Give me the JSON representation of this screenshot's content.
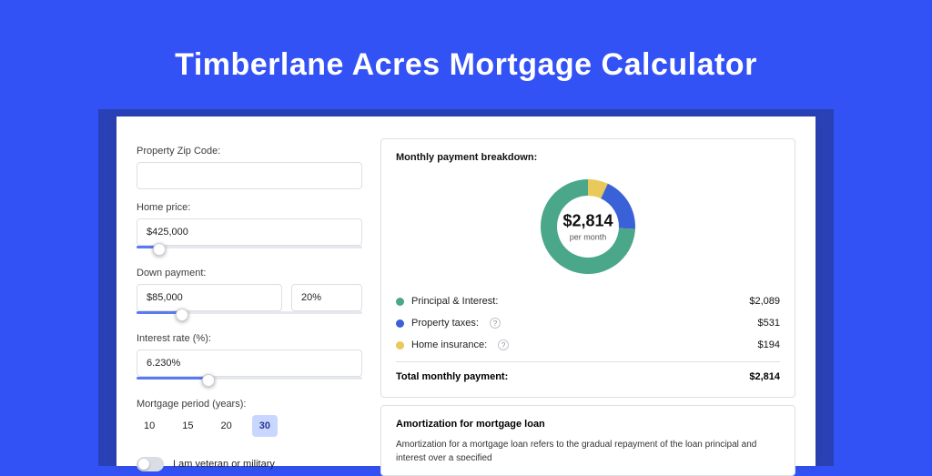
{
  "title": "Timberlane Acres Mortgage Calculator",
  "left": {
    "zip_label": "Property Zip Code:",
    "zip_value": "",
    "home_label": "Home price:",
    "home_value": "$425,000",
    "home_slider_pct": 10,
    "down_label": "Down payment:",
    "down_value": "$85,000",
    "down_pct_value": "20%",
    "down_slider_pct": 20,
    "rate_label": "Interest rate (%):",
    "rate_value": "6.230%",
    "rate_slider_pct": 32,
    "period_label": "Mortgage period (years):",
    "periods": [
      "10",
      "15",
      "20",
      "30"
    ],
    "period_active_index": 3,
    "vet_label": "I am veteran or military",
    "vet_on": false
  },
  "breakdown": {
    "title": "Monthly payment breakdown:",
    "center_value": "$2,814",
    "center_sub": "per month",
    "items": [
      {
        "label": "Principal & Interest:",
        "value": "$2,089",
        "color": "#4aa789",
        "tooltip": false
      },
      {
        "label": "Property taxes:",
        "value": "$531",
        "color": "#3a61d8",
        "tooltip": true
      },
      {
        "label": "Home insurance:",
        "value": "$194",
        "color": "#e8c95a",
        "tooltip": true
      }
    ],
    "total_label": "Total monthly payment:",
    "total_value": "$2,814"
  },
  "amort": {
    "title": "Amortization for mortgage loan",
    "text": "Amortization for a mortgage loan refers to the gradual repayment of the loan principal and interest over a specified"
  },
  "chart_data": {
    "type": "pie",
    "title": "Monthly payment breakdown",
    "series": [
      {
        "name": "Principal & Interest",
        "value": 2089,
        "color": "#4aa789"
      },
      {
        "name": "Property taxes",
        "value": 531,
        "color": "#3a61d8"
      },
      {
        "name": "Home insurance",
        "value": 194,
        "color": "#e8c95a"
      }
    ],
    "total": 2814,
    "units": "USD per month"
  }
}
